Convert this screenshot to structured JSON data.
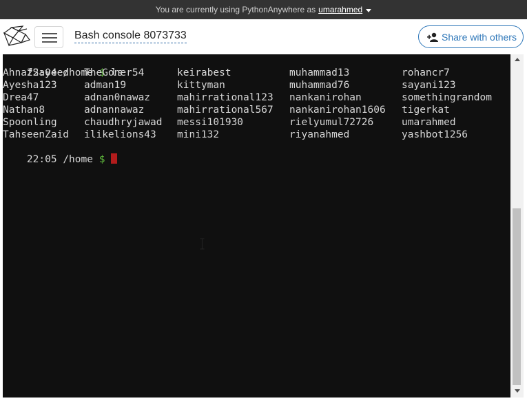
{
  "topbar": {
    "text": "You are currently using PythonAnywhere as",
    "username": "umarahmed"
  },
  "header": {
    "logo_icon": "pythonanywhere-logo-icon",
    "menu_icon": "hamburger-menu-icon",
    "console_title": "Bash console 8073733",
    "share_label": "Share with others",
    "share_icon": "add-user-icon"
  },
  "terminal": {
    "prompt1": {
      "time": "22:04",
      "path": "/home",
      "symbol": "$",
      "command": "ls"
    },
    "listing": [
      [
        "AhnafSayeed",
        "TheGoner54",
        "keirabest",
        "muhammad13",
        "rohancr7"
      ],
      [
        "Ayesha123",
        "adman19",
        "kittyman",
        "muhammad76",
        "sayani123"
      ],
      [
        "Drea47",
        "adnan0nawaz",
        "mahirrational123",
        "nankanirohan",
        "somethingrandom"
      ],
      [
        "Nathan8",
        "adnannawaz",
        "mahirrational567",
        "nankanirohan1606",
        "tigerkat"
      ],
      [
        "Spoonling",
        "chaudhryjawad",
        "messi101930",
        "rielyumul72726",
        "umarahmed"
      ],
      [
        "TahseenZaid",
        "ilikelions43",
        "mini132",
        "riyanahmed",
        "yashbot1256"
      ]
    ],
    "prompt2": {
      "time": "22:05",
      "path": "/home",
      "symbol": "$"
    }
  },
  "colors": {
    "terminal_bg": "#101010",
    "terminal_text": "#d6d6d6",
    "prompt_symbol": "#5fba3c",
    "cursor": "#b21c1c",
    "accent": "#2e77b9"
  }
}
